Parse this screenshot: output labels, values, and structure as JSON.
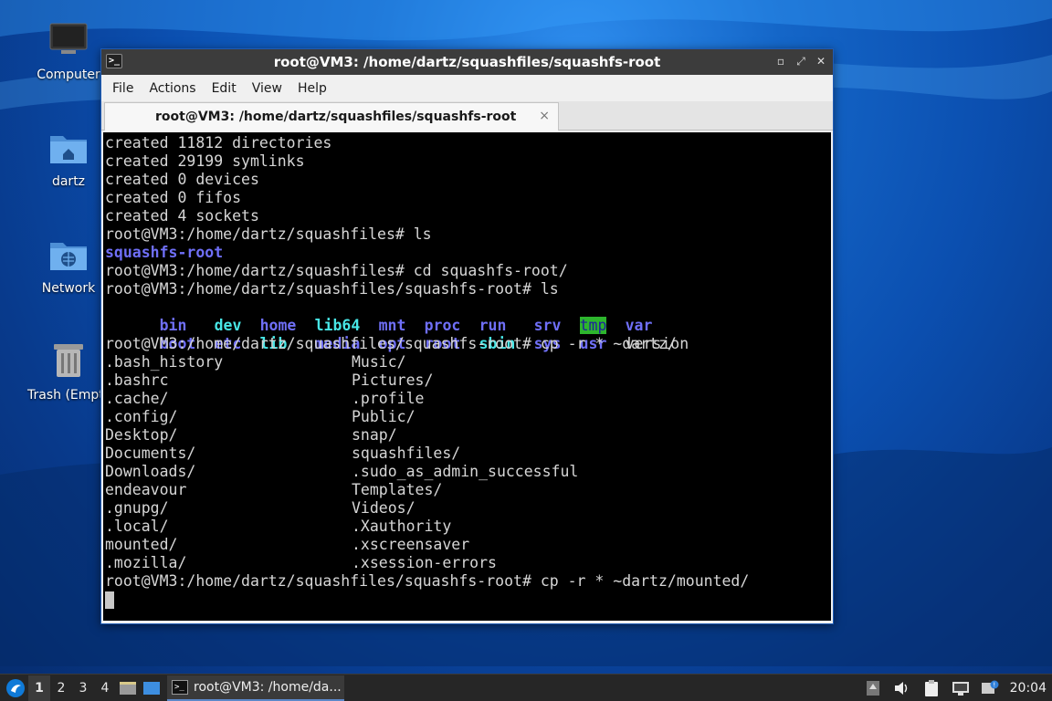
{
  "desktop": {
    "icons": [
      {
        "label": "Computer"
      },
      {
        "label": "dartz"
      },
      {
        "label": "Network"
      },
      {
        "label": "Trash (Empty)"
      }
    ]
  },
  "window": {
    "title": "root@VM3: /home/dartz/squashfiles/squashfs-root",
    "menu": [
      "File",
      "Actions",
      "Edit",
      "View",
      "Help"
    ],
    "tab": {
      "label": "root@VM3: /home/dartz/squashfiles/squashfs-root",
      "close": "×"
    }
  },
  "terminal": {
    "lines_top": [
      "created 11812 directories",
      "created 29199 symlinks",
      "created 0 devices",
      "created 0 fifos",
      "created 4 sockets",
      "root@VM3:/home/dartz/squashfiles# ls"
    ],
    "ls_result_1": "squashfs-root",
    "cmd_cd": "root@VM3:/home/dartz/squashfiles# cd squashfs-root/",
    "cmd_ls": "root@VM3:/home/dartz/squashfiles/squashfs-root# ls",
    "ls_row1": [
      "bin",
      "dev",
      "home",
      "lib64",
      "mnt",
      "proc",
      "run",
      "srv",
      "tmp",
      "var"
    ],
    "ls_row2": [
      "boot",
      "etc",
      "lib",
      "media",
      "opt",
      "root",
      "sbin",
      "sys",
      "usr",
      "version"
    ],
    "cmd_cp1": "root@VM3:/home/dartz/squashfiles/squashfs-root# cp -r * ~dartz/",
    "home_left": [
      ".bash_history",
      ".bashrc",
      ".cache/",
      ".config/",
      "Desktop/",
      "Documents/",
      "Downloads/",
      "endeavour",
      ".gnupg/",
      ".local/",
      "mounted/",
      ".mozilla/"
    ],
    "home_right": [
      "Music/",
      "Pictures/",
      ".profile",
      "Public/",
      "snap/",
      "squashfiles/",
      ".sudo_as_admin_successful",
      "Templates/",
      "Videos/",
      ".Xauthority",
      ".xscreensaver",
      ".xsession-errors"
    ],
    "cmd_cp2": "root@VM3:/home/dartz/squashfiles/squashfs-root# cp -r * ~dartz/mounted/"
  },
  "taskbar": {
    "workspaces": [
      "1",
      "2",
      "3",
      "4"
    ],
    "active_workspace": "1",
    "task_label": "root@VM3: /home/da...",
    "clock": "20:04"
  }
}
